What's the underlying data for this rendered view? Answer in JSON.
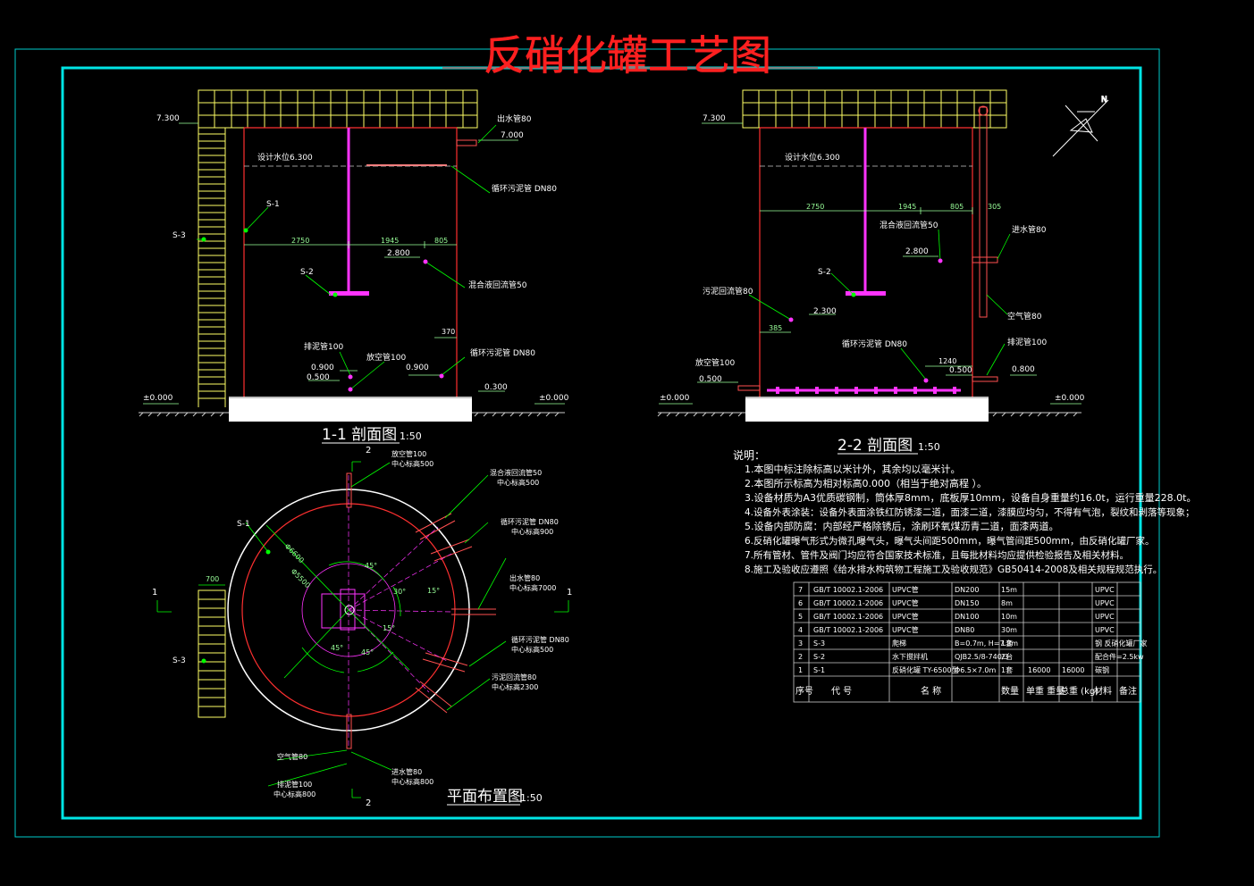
{
  "title": "反硝化罐工艺图",
  "section11": {
    "title": "1-1 剖面图",
    "scale": "1:50",
    "labels": {
      "top_elev": "7.300",
      "outlet": "出水管80",
      "outlet_elev": "7.000",
      "water_level": "设计水位6.300",
      "circ_sludge": "循环污泥管 DN80",
      "s1": "S-1",
      "s3": "S-3",
      "dim_2750": "2750",
      "dim_1945": "1945",
      "dim_805": "805",
      "elev_2800": "2.800",
      "s2": "S-2",
      "mix_return": "混合液回流管50",
      "dim_370": "370",
      "sludge_out": "排泥管100",
      "drain": "放空管100",
      "circ_sludge2": "循环污泥管 DN80",
      "elev_0900a": "0.900",
      "elev_0900b": "0.900",
      "elev_0500": "0.500",
      "elev_0300": "0.300",
      "ground_left": "±0.000",
      "ground_right": "±0.000"
    }
  },
  "section22": {
    "title": "2-2 剖面图",
    "scale": "1:50",
    "labels": {
      "top_elev": "7.300",
      "water_level": "设计水位6.300",
      "dim_2750": "2750",
      "dim_1945": "1945",
      "dim_805": "805",
      "dim_305": "305",
      "mix_return": "混合液回流管50",
      "inlet": "进水管80",
      "elev_2800": "2.800",
      "s2": "S-2",
      "sludge_return": "污泥回流管80",
      "elev_2300": "2.300",
      "air": "空气管80",
      "dim_385": "385",
      "circ_sludge": "循环污泥管 DN80",
      "sludge_out": "排泥管100",
      "dim_1240": "1240",
      "elev_0500a": "0.500",
      "elev_0500b": "0.500",
      "drain": "放空管100",
      "elev_0800": "0.800",
      "ground_left": "±0.000",
      "ground_right": "±0.000"
    }
  },
  "plan": {
    "title": "平面布置图",
    "scale": "1:50",
    "labels": {
      "drain": "放空管100",
      "drain_center": "中心标高500",
      "mix_return": "混合液回流管50",
      "mix_center": "中心标高500",
      "circ_sludge": "循环污泥管 DN80",
      "circ_center": "中心标高900",
      "outlet": "出水管80",
      "outlet_center": "中心标高7000",
      "circ_sludge2": "循环污泥管 DN80",
      "circ2_center": "中心标高500",
      "sludge_return": "污泥回流管80",
      "return_center": "中心标高2300",
      "air": "空气管80",
      "inlet": "进水管80",
      "inlet_center": "中心标高800",
      "sludge_out": "排泥管100",
      "sludge_center": "中心标高800",
      "s1": "S-1",
      "s3": "S-3",
      "dim_700": "700",
      "dim_r1": "Φ6600",
      "dim_r2": "Φ5500",
      "ang_45a": "45°",
      "ang_30": "30°",
      "ang_45b": "45°",
      "ang_45c": "45°",
      "ang_15": "15°",
      "ang_15b": "15°",
      "sec1_left": "1",
      "sec1_right": "1",
      "sec2_top": "2",
      "sec2_bottom": "2"
    }
  },
  "notes": {
    "heading": "说明：",
    "lines": [
      "1.本图中标注除标高以米计外，其余均以毫米计。",
      "2.本图所示标高为相对标高0.000（相当于绝对高程 ）。",
      "3.设备材质为A3优质碳钢制，筒体厚8mm，底板厚10mm，设备自身重量约16.0t，运行重量228.0t。",
      "4.设备外表涂装：设备外表面涂铁红防锈漆二道，面漆二道，漆膜应均匀，不得有气泡，裂纹和剥落等现象；",
      "5.设备内部防腐：内部经严格除锈后，涂刷环氧煤沥青二道，面漆两道。",
      "6.反硝化罐曝气形式为微孔曝气头，曝气头间距500mm，曝气管间距500mm，由反硝化罐厂家。",
      "7.所有管材、管件及阀门均应符合国家技术标准，且每批材料均应提供检验报告及相关材料。",
      "8.施工及验收应遵照《给水排水构筑物工程施工及验收规范》GB50414-2008及相关规程规范执行。"
    ]
  },
  "table": {
    "headers": [
      "序号",
      "代 号",
      "名 称",
      "数量",
      "单重 重量",
      "总重 (kg)",
      "材料",
      "备注"
    ],
    "rows": [
      [
        "7",
        "GB/T 10002.1-2006",
        "UPVC管",
        "DN200",
        "15m",
        "",
        "",
        "UPVC"
      ],
      [
        "6",
        "GB/T 10002.1-2006",
        "UPVC管",
        "DN150",
        "8m",
        "",
        "",
        "UPVC"
      ],
      [
        "5",
        "GB/T 10002.1-2006",
        "UPVC管",
        "DN100",
        "10m",
        "",
        "",
        "UPVC"
      ],
      [
        "4",
        "GB/T 10002.1-2006",
        "UPVC管",
        "DN80",
        "30m",
        "",
        "",
        "UPVC"
      ],
      [
        "3",
        "S-3",
        "爬梯",
        "B=0.7m, H=7.3m",
        "1套",
        "",
        "",
        "钢 反硝化罐厂家"
      ],
      [
        "2",
        "S-2",
        "水下搅拌机",
        "QJB2.5/8-740/3",
        "2台",
        "",
        "",
        "配合件=2.5kw"
      ],
      [
        "1",
        "S-1",
        "反硝化罐 TY-6500型",
        "Φ6.5×7.0m",
        "1套",
        "16000",
        "16000",
        "碳钢"
      ]
    ]
  }
}
